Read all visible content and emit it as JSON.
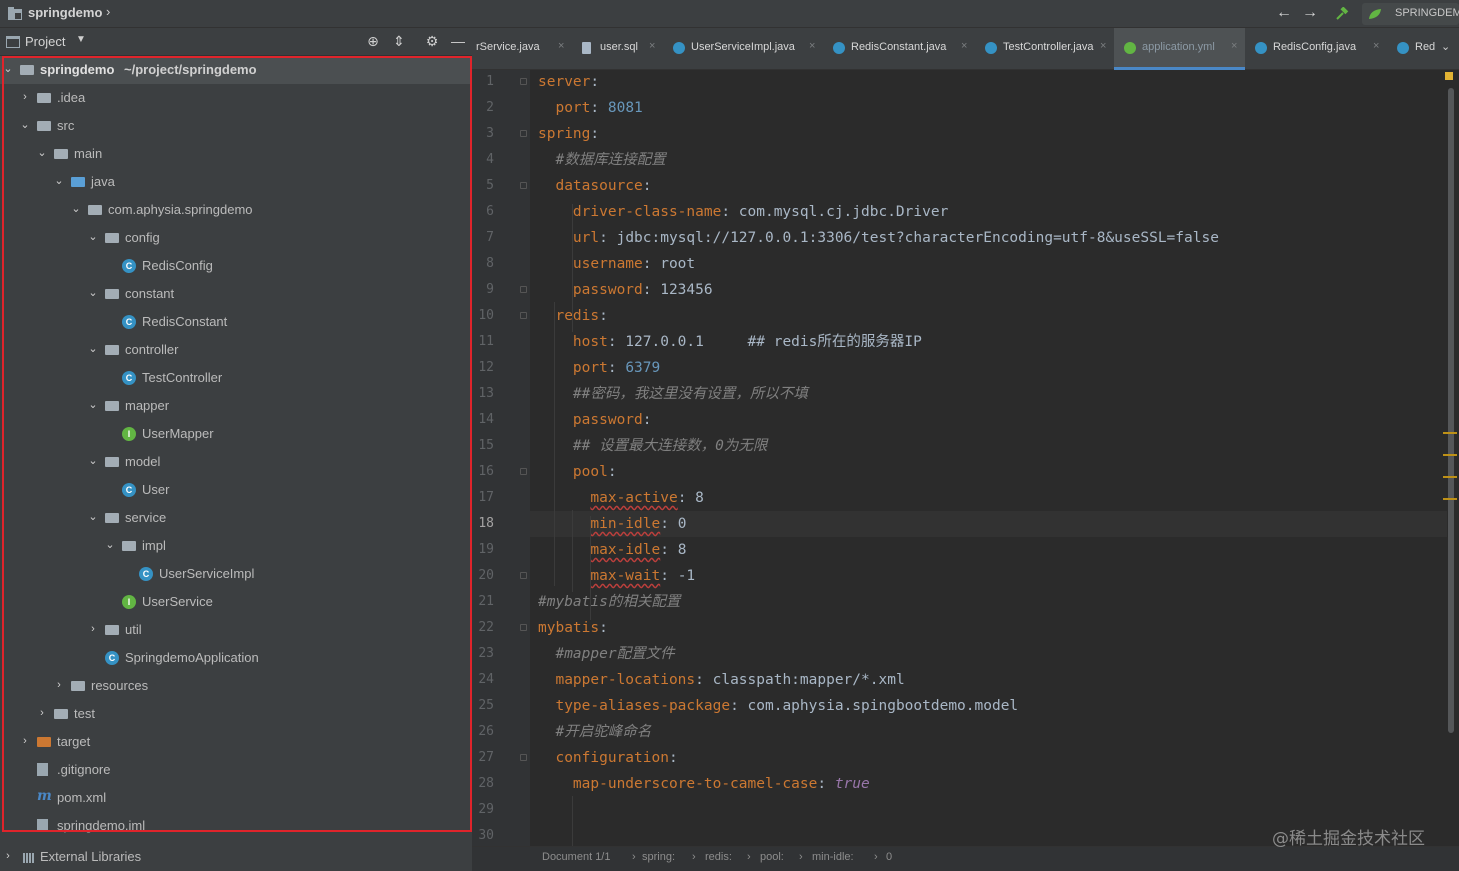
{
  "topbar": {
    "breadcrumb": "springdemo",
    "run_config": "SPRINGDEM"
  },
  "project_panel": {
    "title": "Project",
    "tree": [
      {
        "label": "springdemo",
        "suffix": "~/project/springdemo",
        "depth": 0,
        "kind": "module",
        "expanded": true,
        "selected": true
      },
      {
        "label": ".idea",
        "depth": 1,
        "kind": "folder",
        "expanded": false
      },
      {
        "label": "src",
        "depth": 1,
        "kind": "folder",
        "expanded": true
      },
      {
        "label": "main",
        "depth": 2,
        "kind": "folder",
        "expanded": true
      },
      {
        "label": "java",
        "depth": 3,
        "kind": "source-folder",
        "expanded": true
      },
      {
        "label": "com.aphysia.springdemo",
        "depth": 4,
        "kind": "package",
        "expanded": true
      },
      {
        "label": "config",
        "depth": 5,
        "kind": "package",
        "expanded": true
      },
      {
        "label": "RedisConfig",
        "depth": 6,
        "kind": "class"
      },
      {
        "label": "constant",
        "depth": 5,
        "kind": "package",
        "expanded": true
      },
      {
        "label": "RedisConstant",
        "depth": 6,
        "kind": "class"
      },
      {
        "label": "controller",
        "depth": 5,
        "kind": "package",
        "expanded": true
      },
      {
        "label": "TestController",
        "depth": 6,
        "kind": "class"
      },
      {
        "label": "mapper",
        "depth": 5,
        "kind": "package",
        "expanded": true
      },
      {
        "label": "UserMapper",
        "depth": 6,
        "kind": "interface"
      },
      {
        "label": "model",
        "depth": 5,
        "kind": "package",
        "expanded": true
      },
      {
        "label": "User",
        "depth": 6,
        "kind": "class"
      },
      {
        "label": "service",
        "depth": 5,
        "kind": "package",
        "expanded": true
      },
      {
        "label": "impl",
        "depth": 6,
        "kind": "package",
        "expanded": true
      },
      {
        "label": "UserServiceImpl",
        "depth": 7,
        "kind": "class"
      },
      {
        "label": "UserService",
        "depth": 6,
        "kind": "interface"
      },
      {
        "label": "util",
        "depth": 5,
        "kind": "package",
        "expanded": false
      },
      {
        "label": "SpringdemoApplication",
        "depth": 5,
        "kind": "app-class"
      },
      {
        "label": "resources",
        "depth": 3,
        "kind": "resources",
        "expanded": false
      },
      {
        "label": "test",
        "depth": 2,
        "kind": "folder",
        "expanded": false
      },
      {
        "label": "target",
        "depth": 1,
        "kind": "target-folder",
        "expanded": false
      },
      {
        "label": ".gitignore",
        "depth": 1,
        "kind": "file"
      },
      {
        "label": "pom.xml",
        "depth": 1,
        "kind": "maven"
      },
      {
        "label": "springdemo.iml",
        "depth": 1,
        "kind": "file"
      }
    ],
    "external_libraries": "External Libraries"
  },
  "tabs": [
    {
      "label": "rService.java",
      "icon": "class-icon"
    },
    {
      "label": "user.sql",
      "icon": "sql-icon"
    },
    {
      "label": "UserServiceImpl.java",
      "icon": "class-icon"
    },
    {
      "label": "RedisConstant.java",
      "icon": "class-icon"
    },
    {
      "label": "TestController.java",
      "icon": "class-icon"
    },
    {
      "label": "application.yml",
      "icon": "yml-icon",
      "active": true
    },
    {
      "label": "RedisConfig.java",
      "icon": "class-icon"
    },
    {
      "label": "Red",
      "icon": "class-icon"
    }
  ],
  "editor": {
    "current_line": 18,
    "lines": [
      {
        "n": "1",
        "t": [
          [
            "k",
            "server"
          ],
          [
            "p",
            ":"
          ]
        ]
      },
      {
        "n": "2",
        "t": [
          [
            "p",
            "  "
          ],
          [
            "k",
            "port"
          ],
          [
            "p",
            ": "
          ],
          [
            "n",
            "8081"
          ]
        ]
      },
      {
        "n": "3",
        "t": [
          [
            "k",
            "spring"
          ],
          [
            "p",
            ":"
          ]
        ]
      },
      {
        "n": "4",
        "t": [
          [
            "p",
            "  "
          ],
          [
            "c",
            "#数据库连接配置"
          ]
        ]
      },
      {
        "n": "5",
        "t": [
          [
            "p",
            "  "
          ],
          [
            "k",
            "datasource"
          ],
          [
            "p",
            ":"
          ]
        ]
      },
      {
        "n": "6",
        "t": [
          [
            "p",
            "    "
          ],
          [
            "k",
            "driver-class-name"
          ],
          [
            "p",
            ": com.mysql.cj.jdbc.Driver"
          ]
        ]
      },
      {
        "n": "7",
        "t": [
          [
            "p",
            "    "
          ],
          [
            "k",
            "url"
          ],
          [
            "p",
            ": jdbc:mysql://127.0.0.1:3306/test?characterEncoding=utf-8&useSSL=false"
          ]
        ]
      },
      {
        "n": "8",
        "t": [
          [
            "p",
            "    "
          ],
          [
            "k",
            "username"
          ],
          [
            "p",
            ": root"
          ]
        ]
      },
      {
        "n": "9",
        "t": [
          [
            "p",
            "    "
          ],
          [
            "k",
            "password"
          ],
          [
            "p",
            ": 123456"
          ]
        ]
      },
      {
        "n": "10",
        "t": [
          [
            "p",
            "  "
          ],
          [
            "k",
            "redis"
          ],
          [
            "p",
            ":"
          ]
        ]
      },
      {
        "n": "11",
        "t": [
          [
            "p",
            "    "
          ],
          [
            "k",
            "host"
          ],
          [
            "p",
            ": 127.0.0.1     ## redis所在的服务器IP"
          ]
        ]
      },
      {
        "n": "12",
        "t": [
          [
            "p",
            "    "
          ],
          [
            "k",
            "port"
          ],
          [
            "p",
            ": "
          ],
          [
            "n",
            "6379"
          ]
        ]
      },
      {
        "n": "13",
        "t": [
          [
            "p",
            "    "
          ],
          [
            "c",
            "##密码，我这里没有设置，所以不填"
          ]
        ]
      },
      {
        "n": "14",
        "t": [
          [
            "p",
            "    "
          ],
          [
            "k",
            "password"
          ],
          [
            "p",
            ":"
          ]
        ]
      },
      {
        "n": "15",
        "t": [
          [
            "p",
            "    "
          ],
          [
            "c",
            "## 设置最大连接数，0为无限"
          ]
        ]
      },
      {
        "n": "16",
        "t": [
          [
            "p",
            "    "
          ],
          [
            "k",
            "pool"
          ],
          [
            "p",
            ":"
          ]
        ]
      },
      {
        "n": "17",
        "t": [
          [
            "p",
            "      "
          ],
          [
            "ku",
            "max-active"
          ],
          [
            "p",
            ": 8"
          ]
        ]
      },
      {
        "n": "18",
        "t": [
          [
            "p",
            "      "
          ],
          [
            "ku",
            "min-idle"
          ],
          [
            "p",
            ": 0"
          ]
        ]
      },
      {
        "n": "19",
        "t": [
          [
            "p",
            "      "
          ],
          [
            "ku",
            "max-idle"
          ],
          [
            "p",
            ": 8"
          ]
        ]
      },
      {
        "n": "20",
        "t": [
          [
            "p",
            "      "
          ],
          [
            "ku",
            "max-wait"
          ],
          [
            "p",
            ": -1"
          ]
        ]
      },
      {
        "n": "21",
        "t": [
          [
            "c",
            "#mybatis的相关配置"
          ]
        ]
      },
      {
        "n": "22",
        "t": [
          [
            "k",
            "mybatis"
          ],
          [
            "p",
            ":"
          ]
        ]
      },
      {
        "n": "23",
        "t": [
          [
            "p",
            "  "
          ],
          [
            "c",
            "#mapper配置文件"
          ]
        ]
      },
      {
        "n": "24",
        "t": [
          [
            "p",
            "  "
          ],
          [
            "k",
            "mapper-locations"
          ],
          [
            "p",
            ": classpath:mapper/*.xml"
          ]
        ]
      },
      {
        "n": "25",
        "t": [
          [
            "p",
            "  "
          ],
          [
            "k",
            "type-aliases-package"
          ],
          [
            "p",
            ": com.aphysia.spingbootdemo.model"
          ]
        ]
      },
      {
        "n": "26",
        "t": [
          [
            "p",
            "  "
          ],
          [
            "c",
            "#开启驼峰命名"
          ]
        ]
      },
      {
        "n": "27",
        "t": [
          [
            "p",
            "  "
          ],
          [
            "k",
            "configuration"
          ],
          [
            "p",
            ":"
          ]
        ]
      },
      {
        "n": "28",
        "t": [
          [
            "p",
            "    "
          ],
          [
            "k",
            "map-underscore-to-camel-case"
          ],
          [
            "p",
            ": "
          ],
          [
            "kw",
            "true"
          ]
        ]
      },
      {
        "n": "29",
        "t": []
      },
      {
        "n": "30",
        "t": []
      }
    ]
  },
  "status_bar": {
    "document": "Document 1/1",
    "path": [
      "spring:",
      "redis:",
      "pool:",
      "min-idle:",
      "0"
    ]
  },
  "watermark": "@稀土掘金技术社区",
  "colors": {
    "selection_box": "#e0242b",
    "key": "#cc7832",
    "number": "#6897bb",
    "comment": "#808080"
  }
}
